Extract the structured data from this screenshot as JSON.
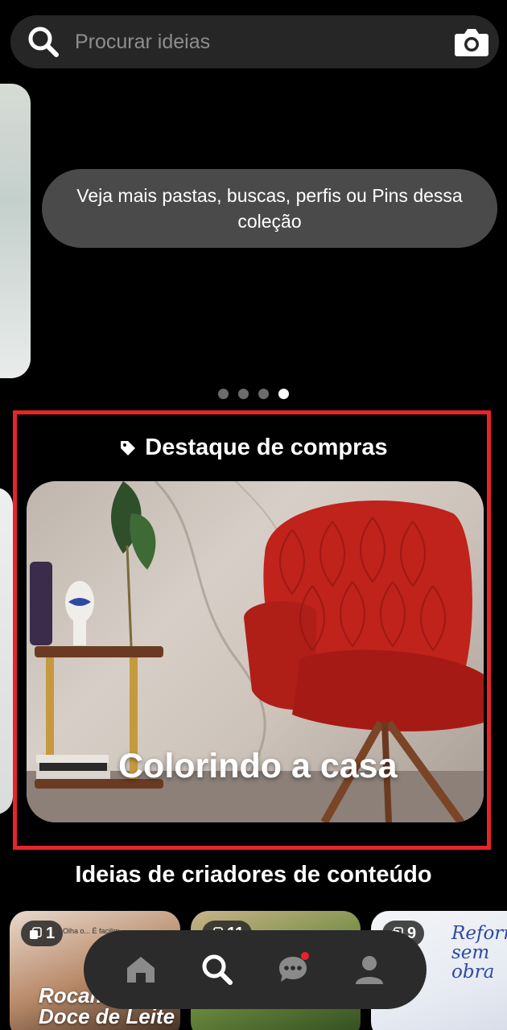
{
  "search": {
    "placeholder": "Procurar ideias"
  },
  "tooltip": {
    "text": "Veja mais pastas, buscas, perfis ou Pins dessa coleção"
  },
  "carousel": {
    "page_count": 4,
    "active_index": 3
  },
  "highlight": {
    "section_title": "Destaque de compras",
    "card_title": "Colorindo a casa",
    "frame_color": "#e8232a"
  },
  "creators": {
    "section_title": "Ideias de criadores de conteúdo",
    "cards": [
      {
        "count": "1",
        "text": "Rocambole Doce de Leite",
        "small": "Olha o... É facilim..."
      },
      {
        "count": "11"
      },
      {
        "count": "9",
        "text": "Reforma sem obra"
      }
    ]
  },
  "nav": {
    "items": [
      "home-icon",
      "search-icon",
      "messages-icon",
      "profile-icon"
    ],
    "active": "search-icon",
    "notification_color": "#e8232a"
  }
}
